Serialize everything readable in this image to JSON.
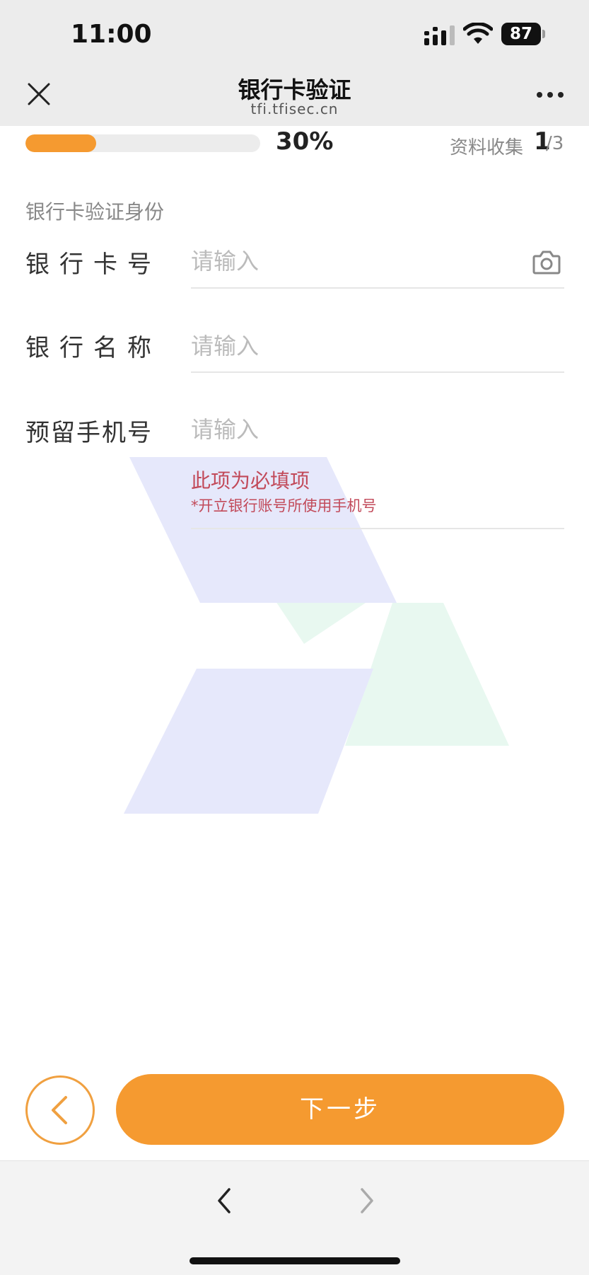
{
  "status_bar": {
    "time": "11:00",
    "battery": "87",
    "icons": [
      "signal-icon",
      "wifi-icon",
      "battery-icon"
    ]
  },
  "nav": {
    "title": "银行卡验证",
    "subtitle": "tfi.tfisec.cn",
    "close_icon": "close-icon",
    "more_icon": "more-icon"
  },
  "progress": {
    "percent_label": "30%",
    "step_label": "资料收集",
    "step_current": "1",
    "step_total": "/3"
  },
  "form": {
    "section_title": "银行卡验证身份",
    "fields": [
      {
        "label": "银行卡号",
        "placeholder": "请输入",
        "value": ""
      },
      {
        "label": "银行名称",
        "placeholder": "请输入",
        "value": ""
      },
      {
        "label": "预留手机号",
        "placeholder": "请输入",
        "value": ""
      }
    ],
    "phone_error": "此项为必填项",
    "phone_hint": "*开立银行账号所使用手机号"
  },
  "actions": {
    "next_label": "下一步",
    "back_icon": "chevron-left-icon"
  },
  "browser": {
    "back_icon": "chevron-left-icon",
    "forward_icon": "chevron-right-icon"
  },
  "colors": {
    "accent": "#f59a30",
    "error": "#c24a5a",
    "watermark_blue": "#e6e8fb",
    "watermark_green": "#e8f8f0"
  }
}
